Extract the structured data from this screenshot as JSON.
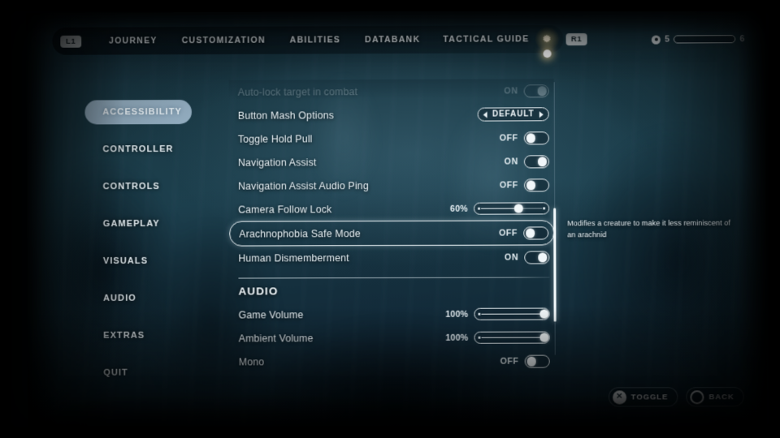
{
  "topnav": {
    "left_bumper": "L1",
    "right_bumper": "R1",
    "tabs": [
      {
        "label": "JOURNEY"
      },
      {
        "label": "CUSTOMIZATION"
      },
      {
        "label": "ABILITIES"
      },
      {
        "label": "DATABANK"
      },
      {
        "label": "TACTICAL GUIDE"
      }
    ],
    "settings_icon": "gear-icon"
  },
  "meter": {
    "icon": "eye-icon",
    "current": "5",
    "max": "6",
    "fill_percent": 14
  },
  "sidebar": {
    "items": [
      {
        "label": "ACCESSIBILITY",
        "active": true
      },
      {
        "label": "CONTROLLER",
        "active": false
      },
      {
        "label": "CONTROLS",
        "active": false
      },
      {
        "label": "GAMEPLAY",
        "active": false
      },
      {
        "label": "VISUALS",
        "active": false
      },
      {
        "label": "AUDIO",
        "active": false
      },
      {
        "label": "EXTRAS",
        "active": false
      },
      {
        "label": "QUIT",
        "active": false
      }
    ]
  },
  "settings": {
    "rows": [
      {
        "label": "Auto-lock target in combat",
        "type": "toggle",
        "state": "ON",
        "on": true,
        "faded": true,
        "selected": false
      },
      {
        "label": "Button Mash Options",
        "type": "stepper",
        "value": "DEFAULT",
        "faded": false,
        "selected": false
      },
      {
        "label": "Toggle Hold Pull",
        "type": "toggle",
        "state": "OFF",
        "on": false,
        "faded": false,
        "selected": false
      },
      {
        "label": "Navigation Assist",
        "type": "toggle",
        "state": "ON",
        "on": true,
        "faded": false,
        "selected": false
      },
      {
        "label": "Navigation Assist Audio Ping",
        "type": "toggle",
        "state": "OFF",
        "on": false,
        "faded": false,
        "selected": false
      },
      {
        "label": "Camera Follow Lock",
        "type": "slider",
        "percent_label": "60%",
        "percent": 60,
        "faded": false,
        "selected": false
      },
      {
        "label": "Arachnophobia Safe Mode",
        "type": "toggle",
        "state": "OFF",
        "on": false,
        "faded": false,
        "selected": true
      },
      {
        "label": "Human Dismemberment",
        "type": "toggle",
        "state": "ON",
        "on": true,
        "faded": false,
        "selected": false
      }
    ],
    "audio_section": {
      "heading": "AUDIO",
      "rows": [
        {
          "label": "Game Volume",
          "type": "slider",
          "percent_label": "100%",
          "percent": 100,
          "faded": false,
          "selected": false
        },
        {
          "label": "Ambient Volume",
          "type": "slider",
          "percent_label": "100%",
          "percent": 100,
          "faded": false,
          "selected": false
        },
        {
          "label": "Mono",
          "type": "toggle",
          "state": "OFF",
          "on": false,
          "faded": false,
          "selected": false
        }
      ]
    }
  },
  "description": {
    "text": "Modifies a creature to make it less reminiscent of an arachnid"
  },
  "prompts": [
    {
      "glyph": "✕",
      "glyph_kind": "cross",
      "label": "TOGGLE"
    },
    {
      "glyph": "",
      "glyph_kind": "circle",
      "label": "BACK"
    }
  ],
  "colors": {
    "accent": "#b0c9dd",
    "text": "#eaf2f6",
    "background": "#1a3945"
  }
}
